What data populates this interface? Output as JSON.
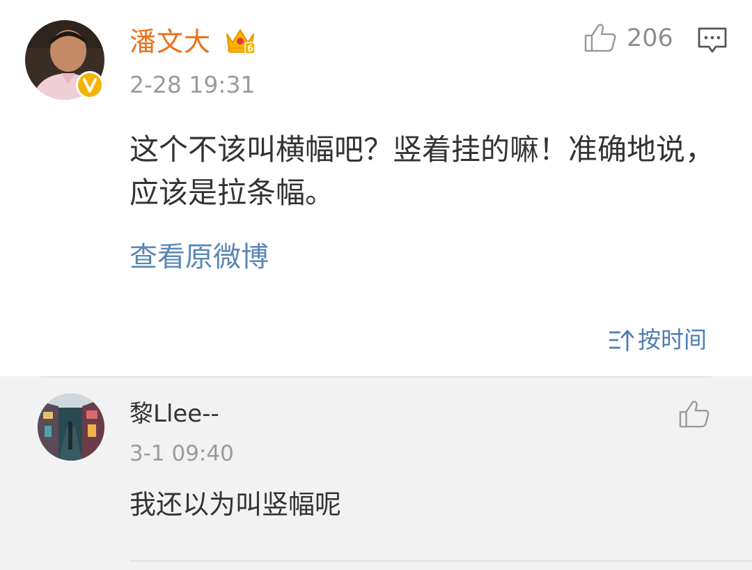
{
  "main_comment": {
    "username": "潘文大",
    "timestamp": "2-28 19:31",
    "like_count": "206",
    "content": "这个不该叫横幅吧？竖着挂的嘛！准确地说，应该是拉条幅。",
    "view_original_label": "查看原微博",
    "verified_badge": "V",
    "icons": {
      "crown": "crown-member-icon",
      "like": "thumbs-up-icon",
      "reply": "comment-icon",
      "verified": "verified-badge-icon"
    }
  },
  "sort_toggle": {
    "label": "按时间",
    "icon": "sort-icon"
  },
  "reply": {
    "username": "黎Llee--",
    "timestamp": "3-1 09:40",
    "content": "我还以为叫竖幅呢",
    "icons": {
      "like": "thumbs-up-icon"
    }
  },
  "colors": {
    "username_orange": "#ee6e18",
    "link_blue": "#5a86b4",
    "secondary_gray": "#9b9b9b",
    "reply_background": "#f2f2f2",
    "badge_yellow": "#f5b400"
  }
}
